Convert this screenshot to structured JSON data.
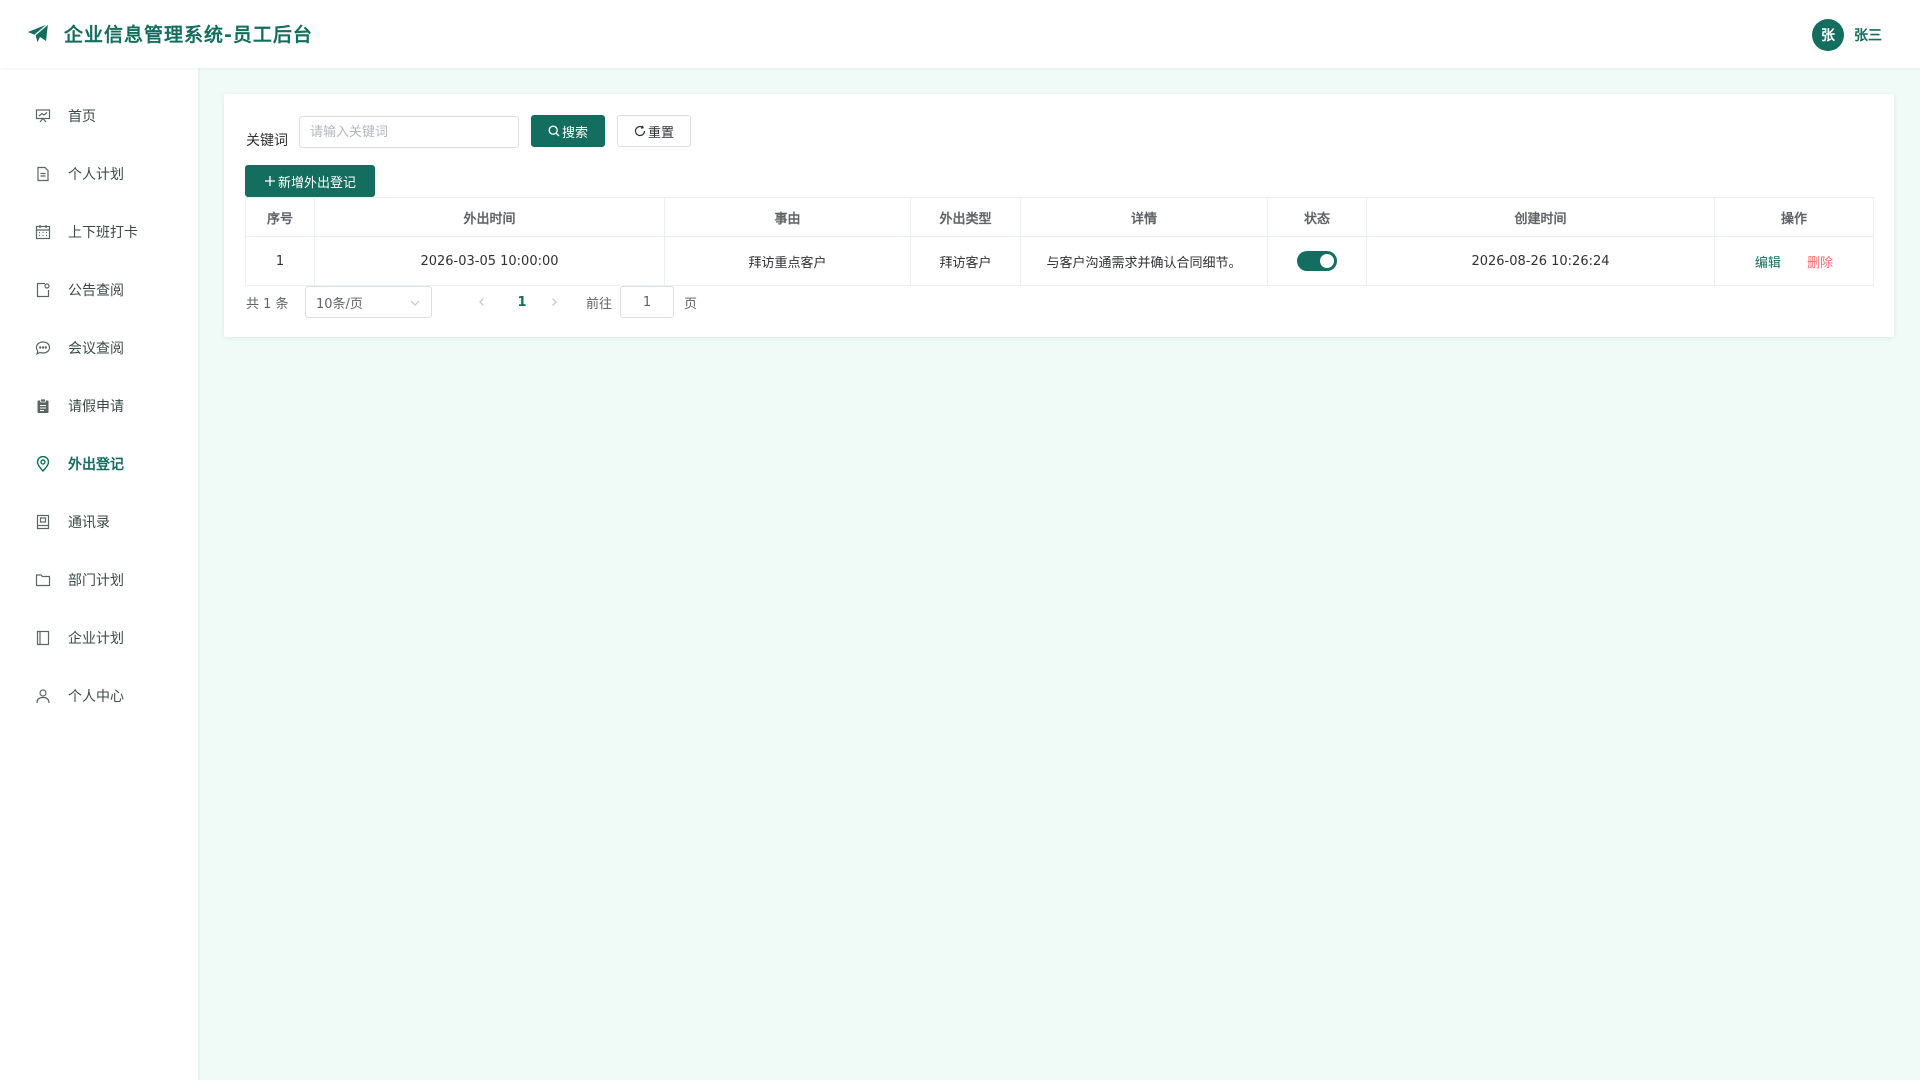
{
  "header": {
    "title": "企业信息管理系统-员工后台",
    "logo_icon": "paper-plane-icon",
    "user": {
      "avatar_text": "张",
      "name": "张三"
    }
  },
  "colors": {
    "accent": "#146e5f",
    "danger": "#f56c6c",
    "page_bg": "#f0fbf8"
  },
  "sidebar": {
    "items": [
      {
        "label": "首页",
        "icon": "presentation-chart-icon",
        "active": false
      },
      {
        "label": "个人计划",
        "icon": "document-icon",
        "active": false
      },
      {
        "label": "上下班打卡",
        "icon": "calendar-icon",
        "active": false
      },
      {
        "label": "公告查阅",
        "icon": "notice-icon",
        "active": false
      },
      {
        "label": "会议查阅",
        "icon": "chat-bubble-icon",
        "active": false
      },
      {
        "label": "请假申请",
        "icon": "clipboard-icon",
        "active": false
      },
      {
        "label": "外出登记",
        "icon": "location-pin-icon",
        "active": true
      },
      {
        "label": "通讯录",
        "icon": "address-book-icon",
        "active": false
      },
      {
        "label": "部门计划",
        "icon": "folder-icon",
        "active": false
      },
      {
        "label": "企业计划",
        "icon": "notebook-icon",
        "active": false
      },
      {
        "label": "个人中心",
        "icon": "user-icon",
        "active": false
      }
    ]
  },
  "search": {
    "label": "关键词",
    "placeholder": "请输入关键词",
    "value": "",
    "search_button": "搜索",
    "reset_button": "重置"
  },
  "actions": {
    "add_button": "新增外出登记"
  },
  "table": {
    "columns": [
      "序号",
      "外出时间",
      "事由",
      "外出类型",
      "详情",
      "状态",
      "创建时间",
      "操作"
    ],
    "rows": [
      {
        "index": "1",
        "out_time": "2026-03-05 10:00:00",
        "reason": "拜访重点客户",
        "type": "拜访客户",
        "detail": "与客户沟通需求并确认合同细节。",
        "status_on": true,
        "created_at": "2026-08-26 10:26:24",
        "edit": "编辑",
        "delete": "删除"
      }
    ]
  },
  "pagination": {
    "total_text": "共 1 条",
    "page_size": "10条/页",
    "current_page": "1",
    "goto_label": "前往",
    "goto_value": "1",
    "page_unit": "页"
  }
}
